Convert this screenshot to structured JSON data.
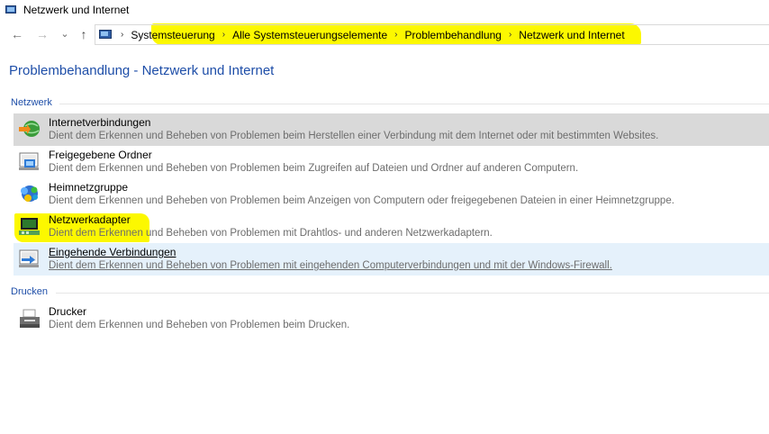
{
  "window": {
    "title": "Netzwerk und Internet"
  },
  "nav": {
    "back_icon": "←",
    "forward_icon": "→",
    "recent_icon": "⌄",
    "up_icon": "↑",
    "breadcrumb": [
      "Systemsteuerung",
      "Alle Systemsteuerungselemente",
      "Problembehandlung",
      "Netzwerk und Internet"
    ],
    "separator": "›"
  },
  "page": {
    "title": "Problembehandlung - Netzwerk und Internet"
  },
  "groups": [
    {
      "label": "Netzwerk",
      "items": [
        {
          "title": "Internetverbindungen",
          "desc": "Dient dem Erkennen und Beheben von Problemen beim Herstellen einer Verbindung mit dem Internet oder mit bestimmten Websites.",
          "icon": "internet-connection-icon"
        },
        {
          "title": "Freigegebene Ordner",
          "desc": "Dient dem Erkennen und Beheben von Problemen beim Zugreifen auf Dateien und Ordner auf anderen Computern.",
          "icon": "shared-folder-icon"
        },
        {
          "title": "Heimnetzgruppe",
          "desc": "Dient dem Erkennen und Beheben von Problemen beim Anzeigen von Computern oder freigegebenen Dateien in einer Heimnetzgruppe.",
          "icon": "homegroup-icon"
        },
        {
          "title": "Netzwerkadapter",
          "desc": "Dient dem Erkennen und Beheben von Problemen mit Drahtlos- und anderen Netzwerkadaptern.",
          "icon": "network-adapter-icon"
        },
        {
          "title": "Eingehende Verbindungen",
          "desc": "Dient dem Erkennen und Beheben von Problemen mit eingehenden Computerverbindungen und mit der Windows-Firewall.",
          "icon": "incoming-connection-icon"
        }
      ]
    },
    {
      "label": "Drucken",
      "items": [
        {
          "title": "Drucker",
          "desc": "Dient dem Erkennen und Beheben von Problemen beim Drucken.",
          "icon": "printer-icon"
        }
      ]
    }
  ],
  "colors": {
    "accent": "#1e4ea8",
    "highlight": "#fcf800",
    "selected": "#d9d9d9",
    "hover": "#e5f1fb"
  }
}
